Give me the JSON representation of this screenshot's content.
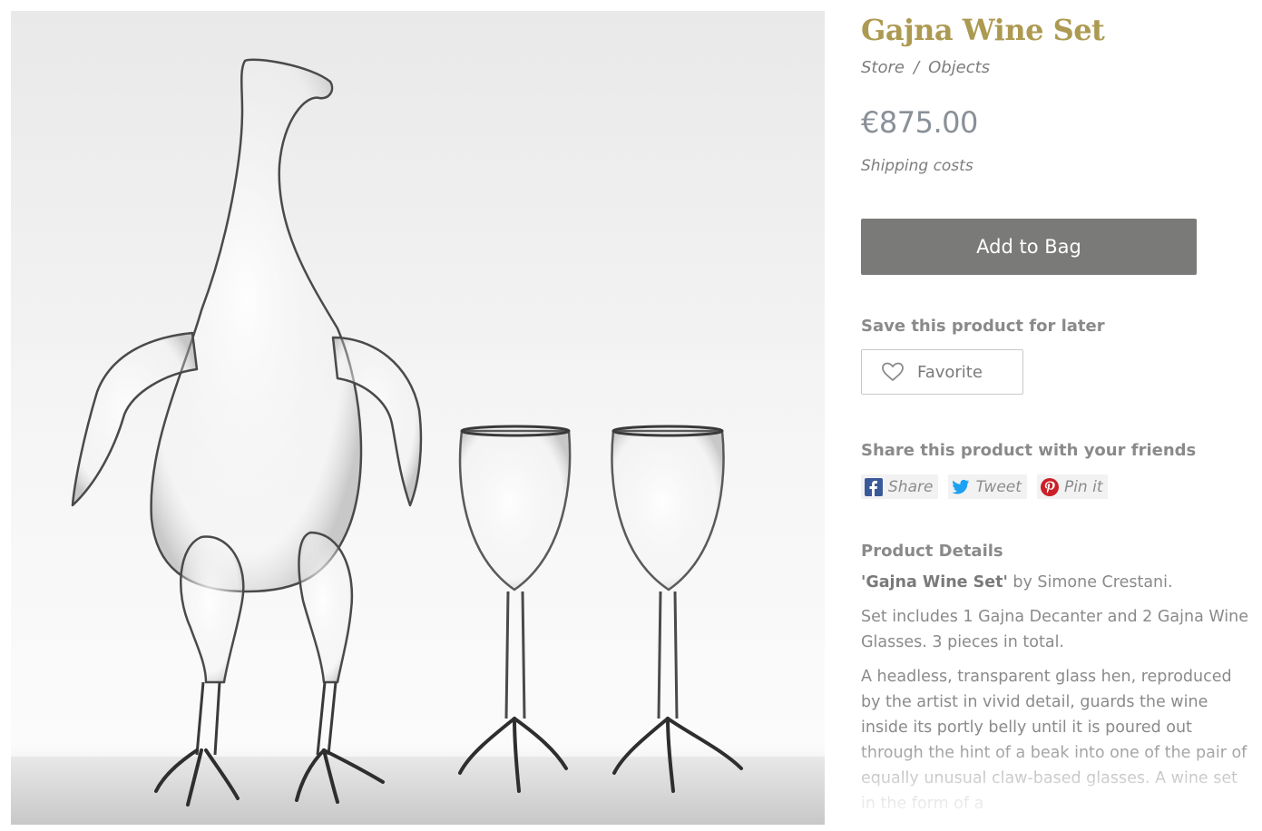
{
  "product": {
    "title": "Gajna Wine Set",
    "breadcrumb": [
      "Store",
      "Objects"
    ],
    "breadcrumb_separator": "/",
    "price": "€875.00",
    "shipping_link": "Shipping costs",
    "add_to_bag": "Add to Bag",
    "save_label": "Save this product for later",
    "favorite": "Favorite",
    "share_label": "Share this product with your friends",
    "share_buttons": [
      {
        "label": "Share",
        "icon": "facebook-icon",
        "color": "#3b5998"
      },
      {
        "label": "Tweet",
        "icon": "twitter-icon",
        "color": "#1da1f2"
      },
      {
        "label": "Pin it",
        "icon": "pinterest-icon",
        "color": "#cb2027"
      }
    ],
    "details_label": "Product Details",
    "details_title": "'Gajna Wine Set'",
    "details_by": " by Simone Crestani.",
    "details_set": "Set includes 1 Gajna Decanter and 2 Gajna Wine Glasses. 3 pieces in total.",
    "details_description": "A headless, transparent glass hen, reproduced by the artist in vivid detail, guards the wine inside its portly belly until it is poured out through the hint of a beak into one of the pair of equally unusual claw-based glasses. A wine set in the form of a"
  },
  "colors": {
    "title": "#ad9a52",
    "button": "#7a7a78",
    "text": "#8a8a8a"
  }
}
